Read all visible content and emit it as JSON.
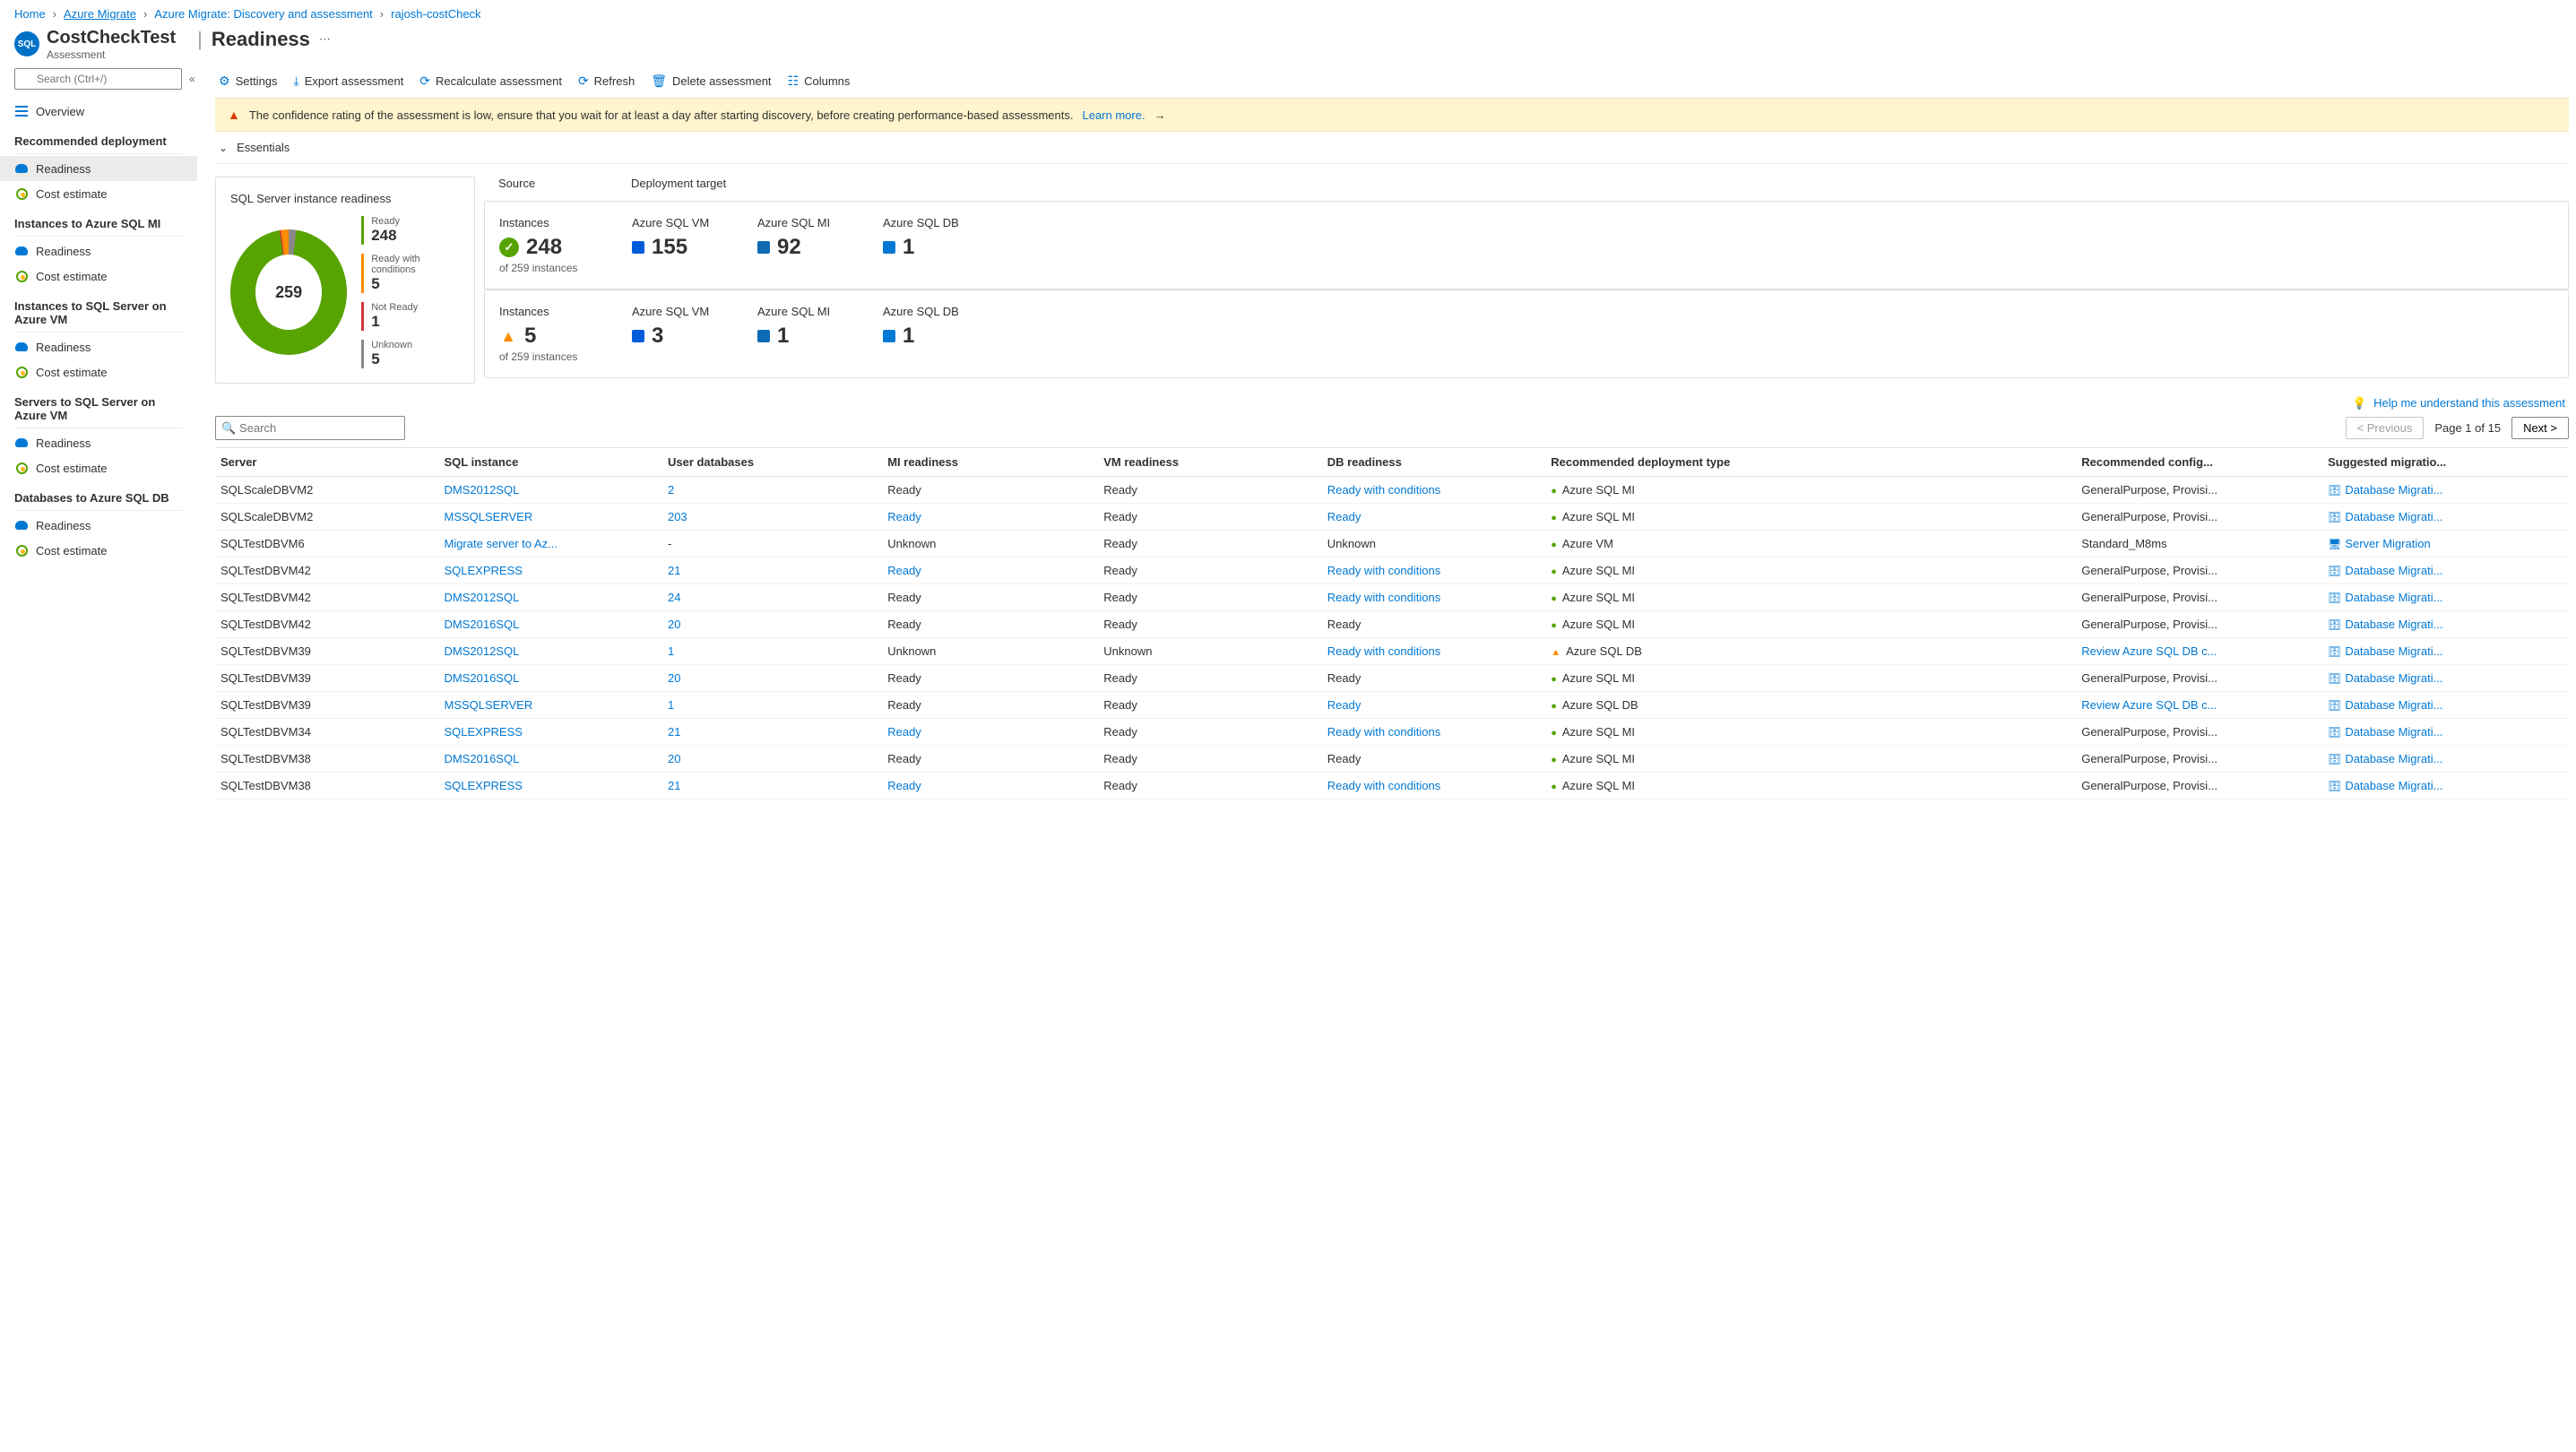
{
  "breadcrumbs": [
    "Home",
    "Azure Migrate",
    "Azure Migrate: Discovery and assessment",
    "rajosh-costCheck"
  ],
  "header": {
    "title": "CostCheckTest",
    "subtitle": "Assessment",
    "pageTitle": "Readiness"
  },
  "sidebar": {
    "searchPlaceholder": "Search (Ctrl+/)",
    "overview": "Overview",
    "sections": [
      {
        "title": "Recommended deployment",
        "items": [
          "Readiness",
          "Cost estimate"
        ],
        "activeIndex": 0
      },
      {
        "title": "Instances to Azure SQL MI",
        "items": [
          "Readiness",
          "Cost estimate"
        ]
      },
      {
        "title": "Instances to SQL Server on Azure VM",
        "items": [
          "Readiness",
          "Cost estimate"
        ]
      },
      {
        "title": "Servers to SQL Server on Azure VM",
        "items": [
          "Readiness",
          "Cost estimate"
        ]
      },
      {
        "title": "Databases to Azure SQL DB",
        "items": [
          "Readiness",
          "Cost estimate"
        ]
      }
    ]
  },
  "toolbar": {
    "settings": "Settings",
    "export": "Export assessment",
    "recalculate": "Recalculate assessment",
    "refresh": "Refresh",
    "delete": "Delete assessment",
    "columns": "Columns"
  },
  "banner": {
    "text": "The confidence rating of the assessment is low, ensure that you wait for at least a day after starting discovery, before creating performance-based assessments.",
    "learnMore": "Learn more."
  },
  "essentials": {
    "label": "Essentials"
  },
  "donutCard": {
    "title": "SQL Server instance readiness",
    "total": "259",
    "legend": [
      {
        "label": "Ready",
        "value": "248",
        "color": "#57a300"
      },
      {
        "label": "Ready with conditions",
        "value": "5",
        "color": "#ff8c00"
      },
      {
        "label": "Not Ready",
        "value": "1",
        "color": "#d13438"
      },
      {
        "label": "Unknown",
        "value": "5",
        "color": "#8a8886"
      }
    ]
  },
  "statLabels": {
    "source": "Source",
    "target": "Deployment target",
    "instances": "Instances",
    "vm": "Azure SQL VM",
    "mi": "Azure SQL MI",
    "db": "Azure SQL DB",
    "ofTotal": "of 259 instances"
  },
  "statCards": [
    {
      "status": "ok",
      "instances": "248",
      "vm": "155",
      "mi": "92",
      "db": "1"
    },
    {
      "status": "warn",
      "instances": "5",
      "vm": "3",
      "mi": "1",
      "db": "1"
    }
  ],
  "helpLink": "Help me understand this assessment",
  "table": {
    "searchPlaceholder": "Search",
    "previous": "< Previous",
    "pageText": "Page 1 of 15",
    "next": "Next >",
    "columns": [
      "Server",
      "SQL instance",
      "User databases",
      "MI readiness",
      "VM readiness",
      "DB readiness",
      "Recommended deployment type",
      "Recommended config...",
      "Suggested migratio..."
    ],
    "rows": [
      {
        "server": "SQLScaleDBVM2",
        "instance": "DMS2012SQL",
        "instanceLink": true,
        "userDb": "2",
        "udLink": true,
        "mi": "Ready",
        "miLink": false,
        "vm": "Ready",
        "db": "Ready with conditions",
        "dbLink": true,
        "rec": "Azure SQL MI",
        "recStatus": "ok",
        "config": "GeneralPurpose, Provisi...",
        "tool": "Database Migrati...",
        "toolType": "db"
      },
      {
        "server": "SQLScaleDBVM2",
        "instance": "MSSQLSERVER",
        "instanceLink": true,
        "userDb": "203",
        "udLink": true,
        "mi": "Ready",
        "miLink": true,
        "vm": "Ready",
        "db": "Ready",
        "dbLink": true,
        "rec": "Azure SQL MI",
        "recStatus": "ok",
        "config": "GeneralPurpose, Provisi...",
        "tool": "Database Migrati...",
        "toolType": "db"
      },
      {
        "server": "SQLTestDBVM6",
        "instance": "Migrate server to Az...",
        "instanceLink": true,
        "userDb": "-",
        "udLink": false,
        "mi": "Unknown",
        "miLink": false,
        "vm": "Ready",
        "db": "Unknown",
        "dbLink": false,
        "rec": "Azure VM",
        "recStatus": "ok",
        "config": "Standard_M8ms",
        "tool": "Server Migration",
        "toolType": "srv"
      },
      {
        "server": "SQLTestDBVM42",
        "instance": "SQLEXPRESS",
        "instanceLink": true,
        "userDb": "21",
        "udLink": true,
        "mi": "Ready",
        "miLink": true,
        "vm": "Ready",
        "db": "Ready with conditions",
        "dbLink": true,
        "rec": "Azure SQL MI",
        "recStatus": "ok",
        "config": "GeneralPurpose, Provisi...",
        "tool": "Database Migrati...",
        "toolType": "db"
      },
      {
        "server": "SQLTestDBVM42",
        "instance": "DMS2012SQL",
        "instanceLink": true,
        "userDb": "24",
        "udLink": true,
        "mi": "Ready",
        "miLink": false,
        "vm": "Ready",
        "db": "Ready with conditions",
        "dbLink": true,
        "rec": "Azure SQL MI",
        "recStatus": "ok",
        "config": "GeneralPurpose, Provisi...",
        "tool": "Database Migrati...",
        "toolType": "db"
      },
      {
        "server": "SQLTestDBVM42",
        "instance": "DMS2016SQL",
        "instanceLink": true,
        "userDb": "20",
        "udLink": true,
        "mi": "Ready",
        "miLink": false,
        "vm": "Ready",
        "db": "Ready",
        "dbLink": false,
        "rec": "Azure SQL MI",
        "recStatus": "ok",
        "config": "GeneralPurpose, Provisi...",
        "tool": "Database Migrati...",
        "toolType": "db"
      },
      {
        "server": "SQLTestDBVM39",
        "instance": "DMS2012SQL",
        "instanceLink": true,
        "userDb": "1",
        "udLink": true,
        "mi": "Unknown",
        "miLink": false,
        "vm": "Unknown",
        "db": "Ready with conditions",
        "dbLink": true,
        "rec": "Azure SQL DB",
        "recStatus": "warn",
        "config": "Review Azure SQL DB c...",
        "configLink": true,
        "tool": "Database Migrati...",
        "toolType": "db"
      },
      {
        "server": "SQLTestDBVM39",
        "instance": "DMS2016SQL",
        "instanceLink": true,
        "userDb": "20",
        "udLink": true,
        "mi": "Ready",
        "miLink": false,
        "vm": "Ready",
        "db": "Ready",
        "dbLink": false,
        "rec": "Azure SQL MI",
        "recStatus": "ok",
        "config": "GeneralPurpose, Provisi...",
        "tool": "Database Migrati...",
        "toolType": "db"
      },
      {
        "server": "SQLTestDBVM39",
        "instance": "MSSQLSERVER",
        "instanceLink": true,
        "userDb": "1",
        "udLink": true,
        "mi": "Ready",
        "miLink": false,
        "vm": "Ready",
        "db": "Ready",
        "dbLink": true,
        "rec": "Azure SQL DB",
        "recStatus": "ok",
        "config": "Review Azure SQL DB c...",
        "configLink": true,
        "tool": "Database Migrati...",
        "toolType": "db"
      },
      {
        "server": "SQLTestDBVM34",
        "instance": "SQLEXPRESS",
        "instanceLink": true,
        "userDb": "21",
        "udLink": true,
        "mi": "Ready",
        "miLink": true,
        "vm": "Ready",
        "db": "Ready with conditions",
        "dbLink": true,
        "rec": "Azure SQL MI",
        "recStatus": "ok",
        "config": "GeneralPurpose, Provisi...",
        "tool": "Database Migrati...",
        "toolType": "db"
      },
      {
        "server": "SQLTestDBVM38",
        "instance": "DMS2016SQL",
        "instanceLink": true,
        "userDb": "20",
        "udLink": true,
        "mi": "Ready",
        "miLink": false,
        "vm": "Ready",
        "db": "Ready",
        "dbLink": false,
        "rec": "Azure SQL MI",
        "recStatus": "ok",
        "config": "GeneralPurpose, Provisi...",
        "tool": "Database Migrati...",
        "toolType": "db"
      },
      {
        "server": "SQLTestDBVM38",
        "instance": "SQLEXPRESS",
        "instanceLink": true,
        "userDb": "21",
        "udLink": true,
        "mi": "Ready",
        "miLink": true,
        "vm": "Ready",
        "db": "Ready with conditions",
        "dbLink": true,
        "rec": "Azure SQL MI",
        "recStatus": "ok",
        "config": "GeneralPurpose, Provisi...",
        "tool": "Database Migrati...",
        "toolType": "db"
      }
    ]
  },
  "chart_data": {
    "type": "pie",
    "title": "SQL Server instance readiness",
    "categories": [
      "Ready",
      "Ready with conditions",
      "Not Ready",
      "Unknown"
    ],
    "values": [
      248,
      5,
      1,
      5
    ],
    "total": 259
  }
}
